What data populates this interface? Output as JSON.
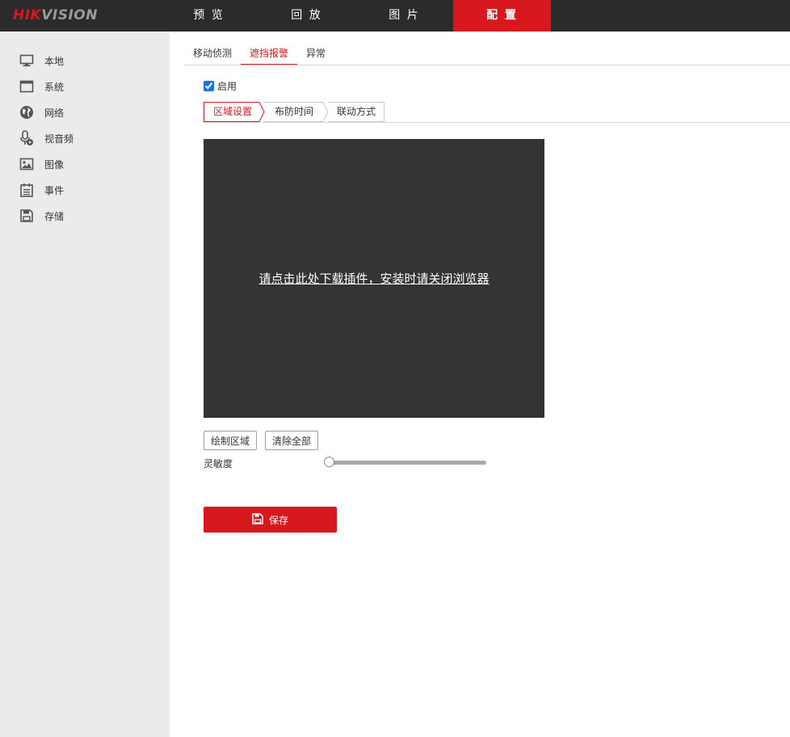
{
  "brand": {
    "logo_hik": "HIK",
    "logo_vision": "VISION"
  },
  "topnav": {
    "items": [
      {
        "label": "预 览"
      },
      {
        "label": "回 放"
      },
      {
        "label": "图 片"
      },
      {
        "label": "配 置",
        "active": true
      }
    ]
  },
  "sidebar": {
    "items": [
      {
        "label": "本地",
        "icon": "monitor-icon"
      },
      {
        "label": "系统",
        "icon": "window-icon"
      },
      {
        "label": "网络",
        "icon": "globe-icon"
      },
      {
        "label": "视音频",
        "icon": "microphone-icon"
      },
      {
        "label": "图像",
        "icon": "image-icon"
      },
      {
        "label": "事件",
        "icon": "calendar-icon"
      },
      {
        "label": "存储",
        "icon": "floppy-disk-icon"
      }
    ]
  },
  "tabs": {
    "items": [
      {
        "label": "移动侦测"
      },
      {
        "label": "遮挡报警",
        "active": true
      },
      {
        "label": "异常"
      }
    ]
  },
  "enable": {
    "label": "启用",
    "checked": true
  },
  "subtabs": {
    "items": [
      {
        "label": "区域设置",
        "active": true
      },
      {
        "label": "布防时间"
      },
      {
        "label": "联动方式"
      }
    ]
  },
  "plugin": {
    "link_text": "请点击此处下载插件，安装时请关闭浏览器"
  },
  "buttons": {
    "draw_area": "绘制区域",
    "clear_all": "清除全部"
  },
  "sensitivity": {
    "label": "灵敏度",
    "value_fraction": 0.0
  },
  "save": {
    "label": "保存"
  },
  "colors": {
    "accent": "#d7191f",
    "topbar": "#2b2b2b",
    "sidebar": "#ebebeb",
    "plugin_bg": "#343434"
  }
}
